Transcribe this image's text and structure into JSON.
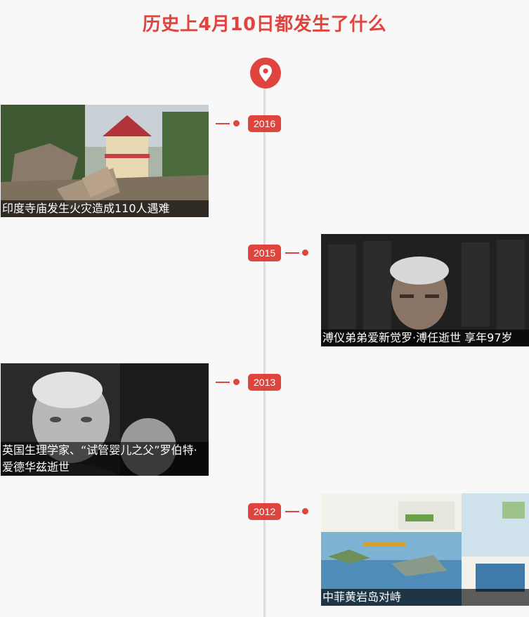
{
  "page": {
    "title": "历史上4月10日都发生了什么"
  },
  "timeline": {
    "marker_icon": "location-pin-icon",
    "accent": "#e0443f",
    "events": [
      {
        "year": "2016",
        "caption": "印度寺庙发生火灾造成110人遇难"
      },
      {
        "year": "2015",
        "caption": "溥仪弟弟爱新觉罗·溥任逝世 享年97岁"
      },
      {
        "year": "2013",
        "caption": "英国生理学家、“试管婴儿之父”罗伯特·爱德华兹逝世"
      },
      {
        "year": "2012",
        "caption": "中菲黄岩岛对峙"
      }
    ]
  }
}
